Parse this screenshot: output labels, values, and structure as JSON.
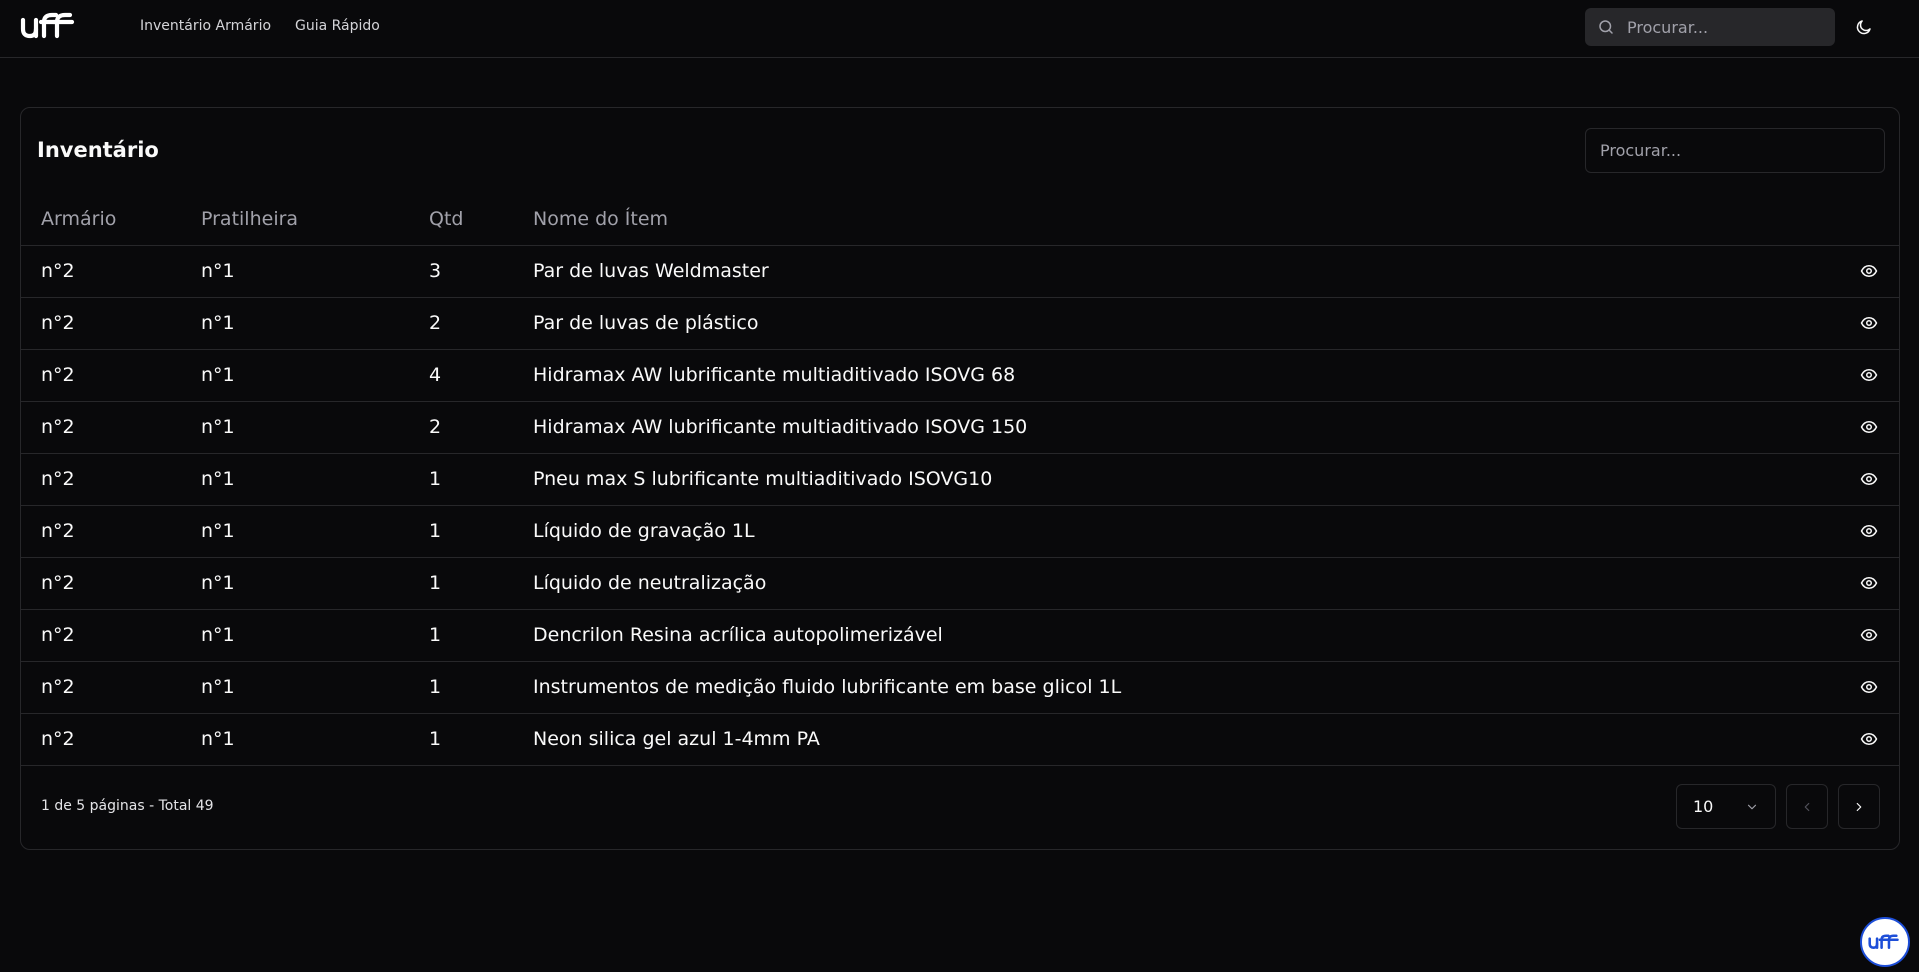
{
  "header": {
    "logo_text": "uff",
    "nav": [
      {
        "label": "Inventário Armário"
      },
      {
        "label": "Guia Rápido"
      }
    ],
    "search_placeholder": "Procurar...",
    "theme_icon": "moon-icon"
  },
  "inventory": {
    "title": "Inventário",
    "search_placeholder": "Procurar...",
    "columns": [
      "Armário",
      "Pratilheira",
      "Qtd",
      "Nome do Ítem"
    ],
    "rows": [
      {
        "armario": "n°2",
        "prateleira": "n°1",
        "qtd": "3",
        "nome": "Par de luvas Weldmaster"
      },
      {
        "armario": "n°2",
        "prateleira": "n°1",
        "qtd": "2",
        "nome": "Par de luvas de plástico"
      },
      {
        "armario": "n°2",
        "prateleira": "n°1",
        "qtd": "4",
        "nome": "Hidramax AW lubrificante multiaditivado ISOVG 68"
      },
      {
        "armario": "n°2",
        "prateleira": "n°1",
        "qtd": "2",
        "nome": "Hidramax AW lubrificante multiaditivado ISOVG 150"
      },
      {
        "armario": "n°2",
        "prateleira": "n°1",
        "qtd": "1",
        "nome": "Pneu max S lubrificante multiaditivado ISOVG10"
      },
      {
        "armario": "n°2",
        "prateleira": "n°1",
        "qtd": "1",
        "nome": "Líquido de gravação 1L"
      },
      {
        "armario": "n°2",
        "prateleira": "n°1",
        "qtd": "1",
        "nome": "Líquido de neutralização"
      },
      {
        "armario": "n°2",
        "prateleira": "n°1",
        "qtd": "1",
        "nome": "Dencrilon Resina acrílica autopolimerizável"
      },
      {
        "armario": "n°2",
        "prateleira": "n°1",
        "qtd": "1",
        "nome": "Instrumentos de medição fluido lubrificante em base glicol 1L"
      },
      {
        "armario": "n°2",
        "prateleira": "n°1",
        "qtd": "1",
        "nome": "Neon silica gel azul 1-4mm PA"
      }
    ],
    "row_action_icon": "eye-icon",
    "pagination": {
      "summary": "1 de 5 páginas - Total 49",
      "page_size": "10"
    }
  },
  "colors": {
    "background": "#09090b",
    "border": "#27272a",
    "muted_text": "#a1a1aa",
    "fab_border": "#1d4ed8"
  }
}
